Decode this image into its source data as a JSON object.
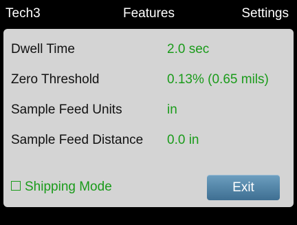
{
  "header": {
    "tabs": [
      {
        "label": "Tech3"
      },
      {
        "label": "Features"
      },
      {
        "label": "Settings"
      }
    ]
  },
  "settings": [
    {
      "label": "Dwell Time",
      "value": "2.0 sec"
    },
    {
      "label": "Zero Threshold",
      "value": "0.13% (0.65 mils)"
    },
    {
      "label": "Sample Feed Units",
      "value": "in"
    },
    {
      "label": "Sample Feed Distance",
      "value": "0.0 in"
    }
  ],
  "shipping_mode": {
    "label": "Shipping Mode",
    "checked": false
  },
  "exit_button": {
    "label": "Exit"
  },
  "colors": {
    "value_green": "#1a9b1a",
    "panel_bg": "#d4d4d4",
    "button_blue": "#5789ab"
  }
}
